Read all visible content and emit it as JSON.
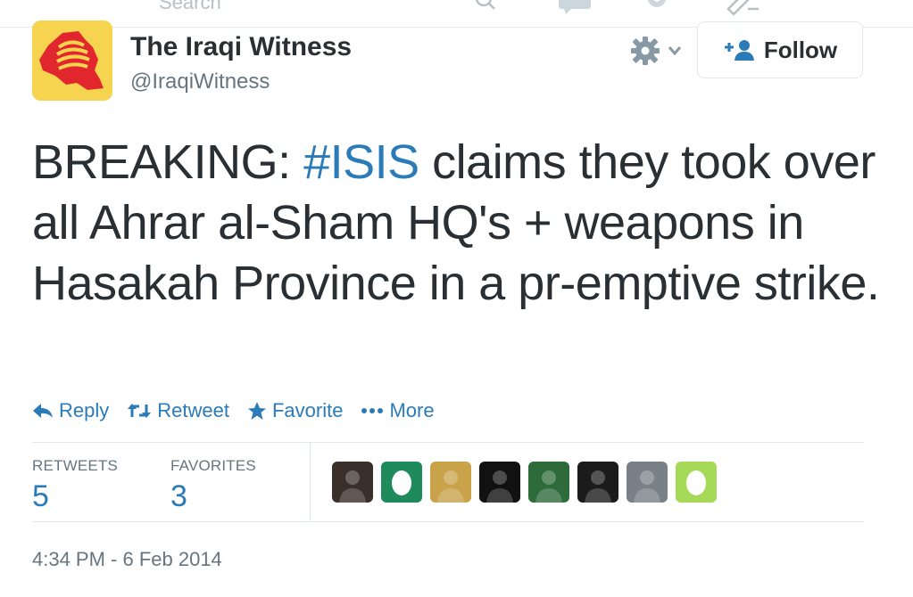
{
  "topbar": {
    "search_text": "Search"
  },
  "author": {
    "name": "The Iraqi Witness",
    "handle": "@IraqiWitness"
  },
  "follow_button": {
    "label": "Follow"
  },
  "tweet": {
    "prefix": "BREAKING: ",
    "hashtag": "#ISIS",
    "suffix": " claims they took over all Ahrar al-Sham HQ's + weapons in Hasakah Province in a pr-emptive strike."
  },
  "actions": {
    "reply": "Reply",
    "retweet": "Retweet",
    "favorite": "Favorite",
    "more": "More"
  },
  "stats": {
    "retweets_label": "RETWEETS",
    "retweets_value": "5",
    "favorites_label": "FAVORITES",
    "favorites_value": "3"
  },
  "favoriters": [
    {
      "kind": "photo",
      "color": "#3a2f2a"
    },
    {
      "kind": "egg",
      "color": "#1f8a5c"
    },
    {
      "kind": "photo",
      "color": "#c9a24a"
    },
    {
      "kind": "photo",
      "color": "#111111"
    },
    {
      "kind": "photo",
      "color": "#2d6b3a"
    },
    {
      "kind": "photo",
      "color": "#1b1b1b"
    },
    {
      "kind": "photo",
      "color": "#7a8088"
    },
    {
      "kind": "egg",
      "color": "#a6d957"
    }
  ],
  "timestamp": "4:34 PM - 6 Feb 2014",
  "colors": {
    "link": "#2b7bb9",
    "text": "#292f33",
    "muted": "#66757f",
    "border": "#e1e8ed"
  }
}
